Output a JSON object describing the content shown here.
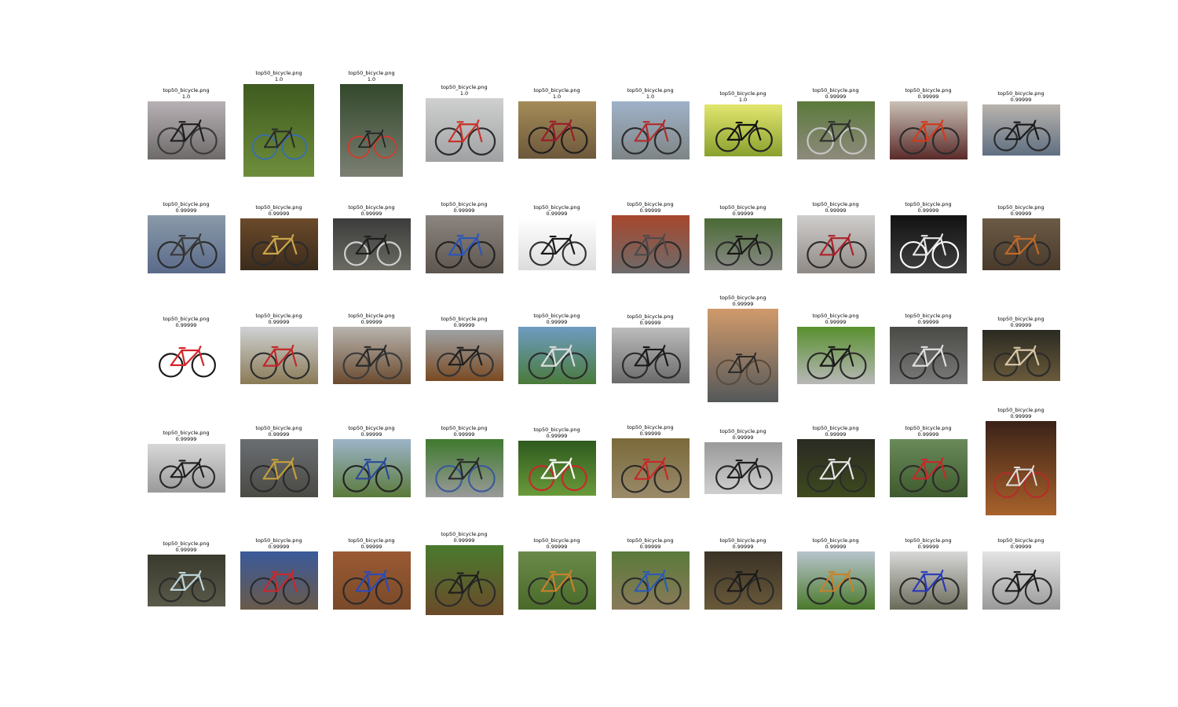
{
  "panels": [
    {
      "file": "top50_bicycle.png",
      "score": "1.0",
      "bg": [
        "#b7b1b6",
        "#6e6a68"
      ],
      "frame": "#1e1e1e",
      "accent": "#3a3a3a"
    },
    {
      "file": "top50_bicycle.png",
      "score": "1.0",
      "bg": [
        "#3f5a1f",
        "#6f8e3c"
      ],
      "frame": "#2a2a2a",
      "accent": "#3a6ea8"
    },
    {
      "file": "top50_bicycle.png",
      "score": "1.0",
      "bg": [
        "#32482b",
        "#7b7f73"
      ],
      "frame": "#232323",
      "accent": "#d23a2a"
    },
    {
      "file": "top50_bicycle.png",
      "score": "1.0",
      "bg": [
        "#cfd0cf",
        "#9fa1a3"
      ],
      "frame": "#c8322a",
      "accent": "#2b2b2b"
    },
    {
      "file": "top50_bicycle.png",
      "score": "1.0",
      "bg": [
        "#a48b58",
        "#6d583b"
      ],
      "frame": "#9a1e2a",
      "accent": "#1e1e1e"
    },
    {
      "file": "top50_bicycle.png",
      "score": "1.0",
      "bg": [
        "#9fb2c8",
        "#7e8585"
      ],
      "frame": "#b12b2b",
      "accent": "#2b2b2b"
    },
    {
      "file": "top50_bicycle.png",
      "score": "1.0",
      "bg": [
        "#e2e66e",
        "#8aa02e"
      ],
      "frame": "#111111",
      "accent": "#222222"
    },
    {
      "file": "top50_bicycle.png",
      "score": "0.99999",
      "bg": [
        "#5c7a3c",
        "#8d8a7c"
      ],
      "frame": "#2f2f2f",
      "accent": "#c6c6c6"
    },
    {
      "file": "top50_bicycle.png",
      "score": "0.99999",
      "bg": [
        "#c9c1b6",
        "#5a2a2a"
      ],
      "frame": "#d23a1a",
      "accent": "#2b2b2b"
    },
    {
      "file": "top50_bicycle.png",
      "score": "0.99999",
      "bg": [
        "#b8b3ad",
        "#5f6f82"
      ],
      "frame": "#1a1a1a",
      "accent": "#2b2b2b"
    },
    {
      "file": "top50_bicycle.png",
      "score": "0.99999",
      "bg": [
        "#8a9aa8",
        "#5a6a8a"
      ],
      "frame": "#3a3a3a",
      "accent": "#2b2b2b"
    },
    {
      "file": "top50_bicycle.png",
      "score": "0.99999",
      "bg": [
        "#6b4a2a",
        "#3a2b1c"
      ],
      "frame": "#c9a64a",
      "accent": "#2b2b2b"
    },
    {
      "file": "top50_bicycle.png",
      "score": "0.99999",
      "bg": [
        "#3c3c3c",
        "#6a6a62"
      ],
      "frame": "#1f1f1f",
      "accent": "#cfcfcf"
    },
    {
      "file": "top50_bicycle.png",
      "score": "0.99999",
      "bg": [
        "#8c8580",
        "#5d564e"
      ],
      "frame": "#2b55b8",
      "accent": "#222222"
    },
    {
      "file": "top50_bicycle.png",
      "score": "0.99999",
      "bg": [
        "#ffffff",
        "#dcdcdc"
      ],
      "frame": "#1a1a1a",
      "accent": "#333333"
    },
    {
      "file": "top50_bicycle.png",
      "score": "0.99999",
      "bg": [
        "#a8472d",
        "#6c6c6c"
      ],
      "frame": "#4a4a4a",
      "accent": "#2b2b2b"
    },
    {
      "file": "top50_bicycle.png",
      "score": "0.99999",
      "bg": [
        "#4a6a35",
        "#8a8a86"
      ],
      "frame": "#1a1a1a",
      "accent": "#2b2b2b"
    },
    {
      "file": "top50_bicycle.png",
      "score": "0.99999",
      "bg": [
        "#cfcdcb",
        "#8f8a86"
      ],
      "frame": "#b0202a",
      "accent": "#2b2b2b"
    },
    {
      "file": "top50_bicycle.png",
      "score": "0.99999",
      "bg": [
        "#121212",
        "#404040"
      ],
      "frame": "#e8e8e8",
      "accent": "#ffffff"
    },
    {
      "file": "top50_bicycle.png",
      "score": "0.99999",
      "bg": [
        "#6a5a45",
        "#4a3a2b"
      ],
      "frame": "#c16a2a",
      "accent": "#2b2b2b"
    },
    {
      "file": "top50_bicycle.png",
      "score": "0.99999",
      "bg": [
        "#ffffff",
        "#ffffff"
      ],
      "frame": "#d4242a",
      "accent": "#1a1a1a"
    },
    {
      "file": "top50_bicycle.png",
      "score": "0.99999",
      "bg": [
        "#cfd2d4",
        "#8a7a56"
      ],
      "frame": "#c0282a",
      "accent": "#2b2b2b"
    },
    {
      "file": "top50_bicycle.png",
      "score": "0.99999",
      "bg": [
        "#b8b4ae",
        "#6a4a2e"
      ],
      "frame": "#2b2b2b",
      "accent": "#3a3a3a"
    },
    {
      "file": "top50_bicycle.png",
      "score": "0.99999",
      "bg": [
        "#9ea2a4",
        "#7a4a22"
      ],
      "frame": "#1e1e1e",
      "accent": "#333333"
    },
    {
      "file": "top50_bicycle.png",
      "score": "0.99999",
      "bg": [
        "#6e9cc2",
        "#4a7a3a"
      ],
      "frame": "#dcdcdc",
      "accent": "#2b2b2b"
    },
    {
      "file": "top50_bicycle.png",
      "score": "0.99999",
      "bg": [
        "#bcbcbc",
        "#6a6a6a"
      ],
      "frame": "#1a1a1a",
      "accent": "#2b2b2b"
    },
    {
      "file": "top50_bicycle.png",
      "score": "0.99999",
      "bg": [
        "#d09a6a",
        "#54585a"
      ],
      "frame": "#2a2a2a",
      "accent": "#5a4a3a"
    },
    {
      "file": "top50_bicycle.png",
      "score": "0.99999",
      "bg": [
        "#58902e",
        "#b8b8b8"
      ],
      "frame": "#1a1a1a",
      "accent": "#2b2b2b"
    },
    {
      "file": "top50_bicycle.png",
      "score": "0.99999",
      "bg": [
        "#4a4a46",
        "#7a7a7a"
      ],
      "frame": "#e0e0e0",
      "accent": "#2b2b2b"
    },
    {
      "file": "top50_bicycle.png",
      "score": "0.99999",
      "bg": [
        "#2a2a22",
        "#6a5a3a"
      ],
      "frame": "#d8c8a8",
      "accent": "#2b2b2b"
    },
    {
      "file": "top50_bicycle.png",
      "score": "0.99999",
      "bg": [
        "#d8d8d8",
        "#9a9a9a"
      ],
      "frame": "#1e1e1e",
      "accent": "#2b2b2b"
    },
    {
      "file": "top50_bicycle.png",
      "score": "0.99999",
      "bg": [
        "#6a6e72",
        "#4a4a44"
      ],
      "frame": "#c8a03a",
      "accent": "#2b2b2b"
    },
    {
      "file": "top50_bicycle.png",
      "score": "0.99999",
      "bg": [
        "#9cb4c8",
        "#5a7a3a"
      ],
      "frame": "#2a4a9a",
      "accent": "#222222"
    },
    {
      "file": "top50_bicycle.png",
      "score": "0.99999",
      "bg": [
        "#3f7a2e",
        "#9a9a9a"
      ],
      "frame": "#2a2a2a",
      "accent": "#3a5a9a"
    },
    {
      "file": "top50_bicycle.png",
      "score": "0.99999",
      "bg": [
        "#2e5a1e",
        "#6a9a3a"
      ],
      "frame": "#ffffff",
      "accent": "#c8282a"
    },
    {
      "file": "top50_bicycle.png",
      "score": "0.99999",
      "bg": [
        "#7a6a3a",
        "#9a8a6a"
      ],
      "frame": "#c8282a",
      "accent": "#2b2b2b"
    },
    {
      "file": "top50_bicycle.png",
      "score": "0.99999",
      "bg": [
        "#9a9a9a",
        "#cfcfcf"
      ],
      "frame": "#1e1e1e",
      "accent": "#2b2b2b"
    },
    {
      "file": "top50_bicycle.png",
      "score": "0.99999",
      "bg": [
        "#2a2a22",
        "#3e4a1e"
      ],
      "frame": "#e8e8e8",
      "accent": "#2b2b2b"
    },
    {
      "file": "top50_bicycle.png",
      "score": "0.99999",
      "bg": [
        "#6a8a5a",
        "#3e5a2e"
      ],
      "frame": "#c8282a",
      "accent": "#2b2b2b"
    },
    {
      "file": "top50_bicycle.png",
      "score": "0.99999",
      "bg": [
        "#3a2218",
        "#a8622a"
      ],
      "frame": "#e0e0e0",
      "accent": "#b82a2a"
    },
    {
      "file": "top50_bicycle.png",
      "score": "0.99999",
      "bg": [
        "#3a3a2e",
        "#5a5a4a"
      ],
      "frame": "#bcd4d8",
      "accent": "#2b2b2b"
    },
    {
      "file": "top50_bicycle.png",
      "score": "0.99999",
      "bg": [
        "#3a5a9a",
        "#6a5a4a"
      ],
      "frame": "#c8282a",
      "accent": "#2b2b2b"
    },
    {
      "file": "top50_bicycle.png",
      "score": "0.99999",
      "bg": [
        "#9a5a32",
        "#7a4a2a"
      ],
      "frame": "#2a4ab8",
      "accent": "#2b2b2b"
    },
    {
      "file": "top50_bicycle.png",
      "score": "0.99999",
      "bg": [
        "#4a7a2e",
        "#6a4a2a"
      ],
      "frame": "#1e1e1e",
      "accent": "#2b2b2b"
    },
    {
      "file": "top50_bicycle.png",
      "score": "0.99999",
      "bg": [
        "#6a8a4a",
        "#4a6a2a"
      ],
      "frame": "#c8822a",
      "accent": "#2b2b2b"
    },
    {
      "file": "top50_bicycle.png",
      "score": "0.99999",
      "bg": [
        "#5a7a3a",
        "#8a7a5a"
      ],
      "frame": "#2a5ab8",
      "accent": "#2b2b2b"
    },
    {
      "file": "top50_bicycle.png",
      "score": "0.99999",
      "bg": [
        "#3a3226",
        "#6a5a3a"
      ],
      "frame": "#1a1a1a",
      "accent": "#2b2b2b"
    },
    {
      "file": "top50_bicycle.png",
      "score": "0.99999",
      "bg": [
        "#b8c4cc",
        "#4a7a2a"
      ],
      "frame": "#c8822a",
      "accent": "#2b2b2b"
    },
    {
      "file": "top50_bicycle.png",
      "score": "0.99999",
      "bg": [
        "#d8d8d8",
        "#6a6a5a"
      ],
      "frame": "#2a3ab8",
      "accent": "#2b2b2b"
    },
    {
      "file": "top50_bicycle.png",
      "score": "0.99999",
      "bg": [
        "#e4e4e4",
        "#9a9a9a"
      ],
      "frame": "#1a1a1a",
      "accent": "#2b2b2b"
    }
  ]
}
